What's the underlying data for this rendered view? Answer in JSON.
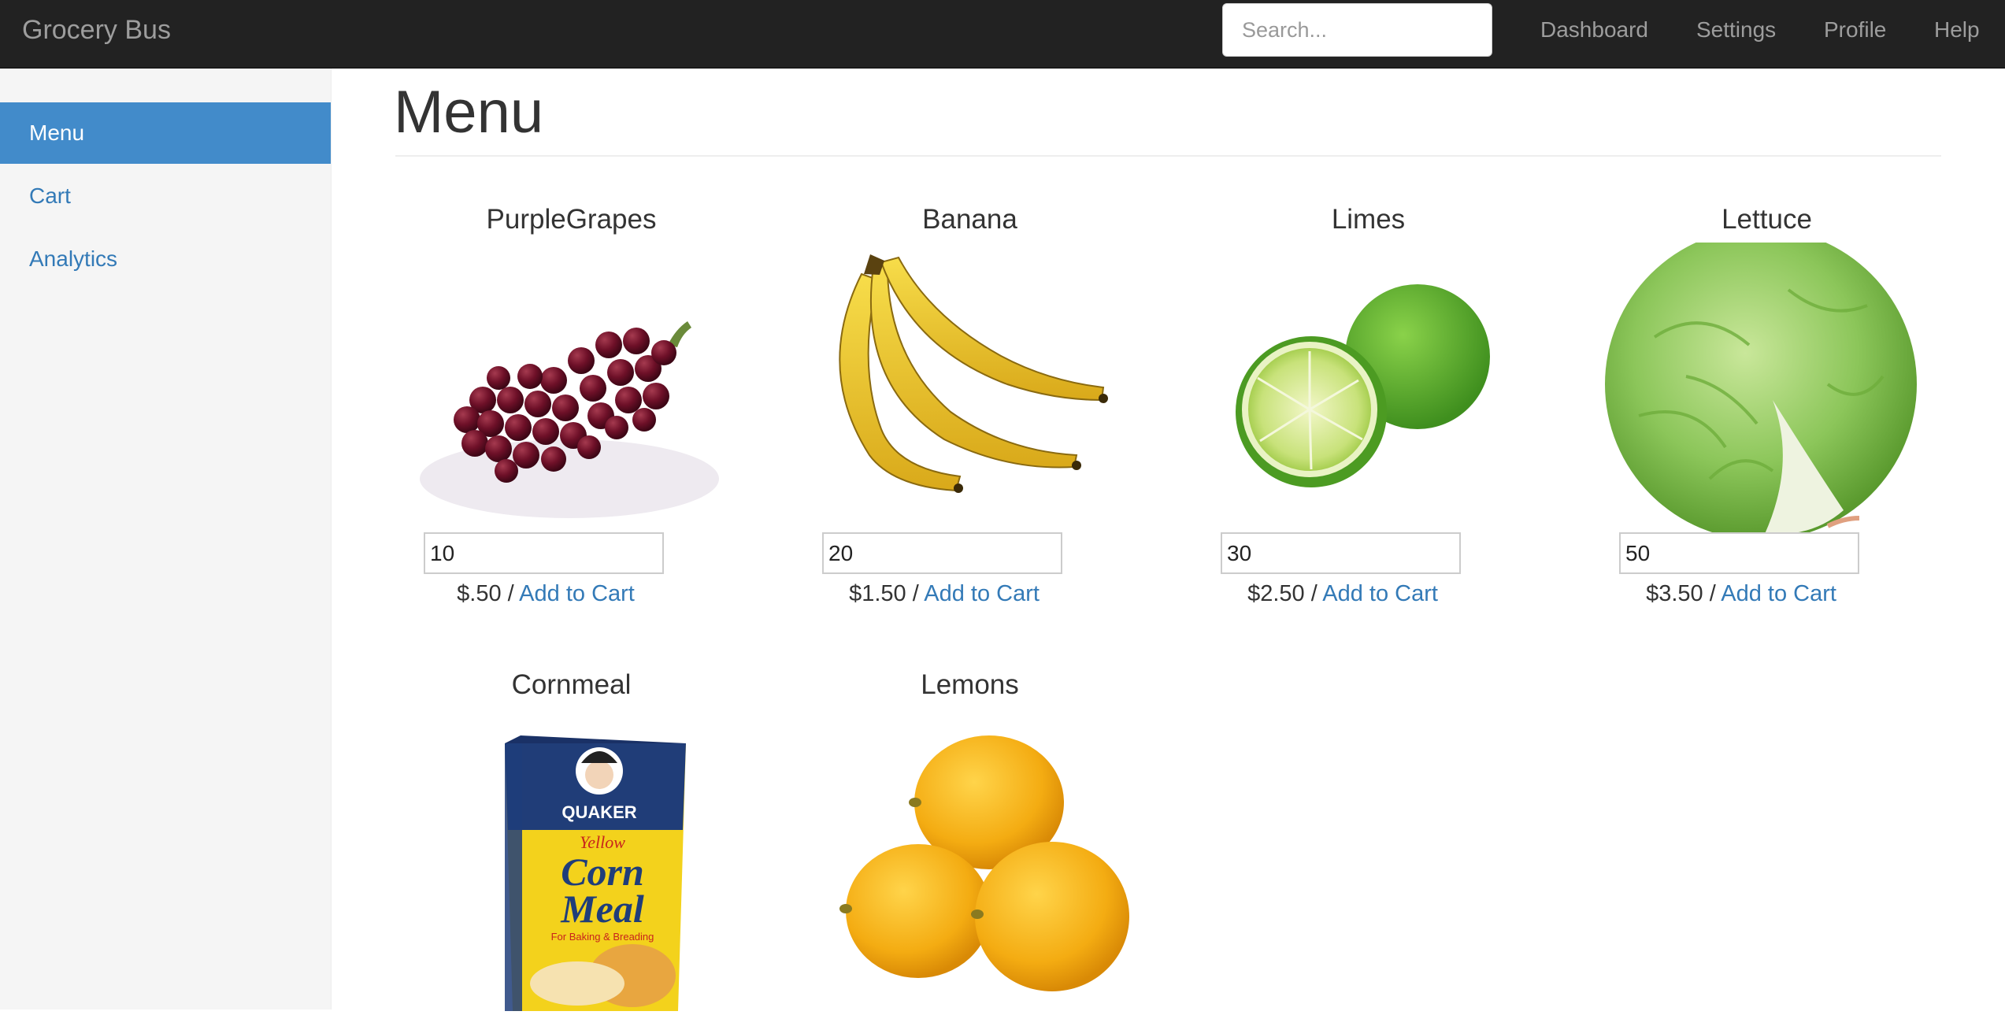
{
  "navbar": {
    "brand": "Grocery Bus",
    "search_placeholder": "Search...",
    "links": [
      "Dashboard",
      "Settings",
      "Profile",
      "Help"
    ]
  },
  "sidebar": {
    "items": [
      {
        "label": "Menu",
        "active": true
      },
      {
        "label": "Cart",
        "active": false
      },
      {
        "label": "Analytics",
        "active": false
      }
    ]
  },
  "main": {
    "title": "Menu",
    "price_separator": " / ",
    "add_label": "Add to Cart",
    "products": [
      {
        "name": "PurpleGrapes",
        "qty": "10",
        "price": "$.50",
        "image": "purple-grapes-image"
      },
      {
        "name": "Banana",
        "qty": "20",
        "price": "$1.50",
        "image": "banana-image"
      },
      {
        "name": "Limes",
        "qty": "30",
        "price": "$2.50",
        "image": "limes-image"
      },
      {
        "name": "Lettuce",
        "qty": "50",
        "price": "$3.50",
        "image": "lettuce-image"
      },
      {
        "name": "Cornmeal",
        "image": "cornmeal-box-image"
      },
      {
        "name": "Lemons",
        "image": "lemons-image"
      }
    ]
  },
  "cornmeal_box": {
    "brand": "QUAKER",
    "line1": "Yellow",
    "line2": "Corn",
    "line3": "Meal",
    "tagline": "For Baking & Breading"
  },
  "colors": {
    "navbar_bg": "#222222",
    "nav_text": "#9d9d9d",
    "sidebar_bg": "#f5f5f5",
    "active_bg": "#428bca",
    "link": "#337ab7"
  }
}
